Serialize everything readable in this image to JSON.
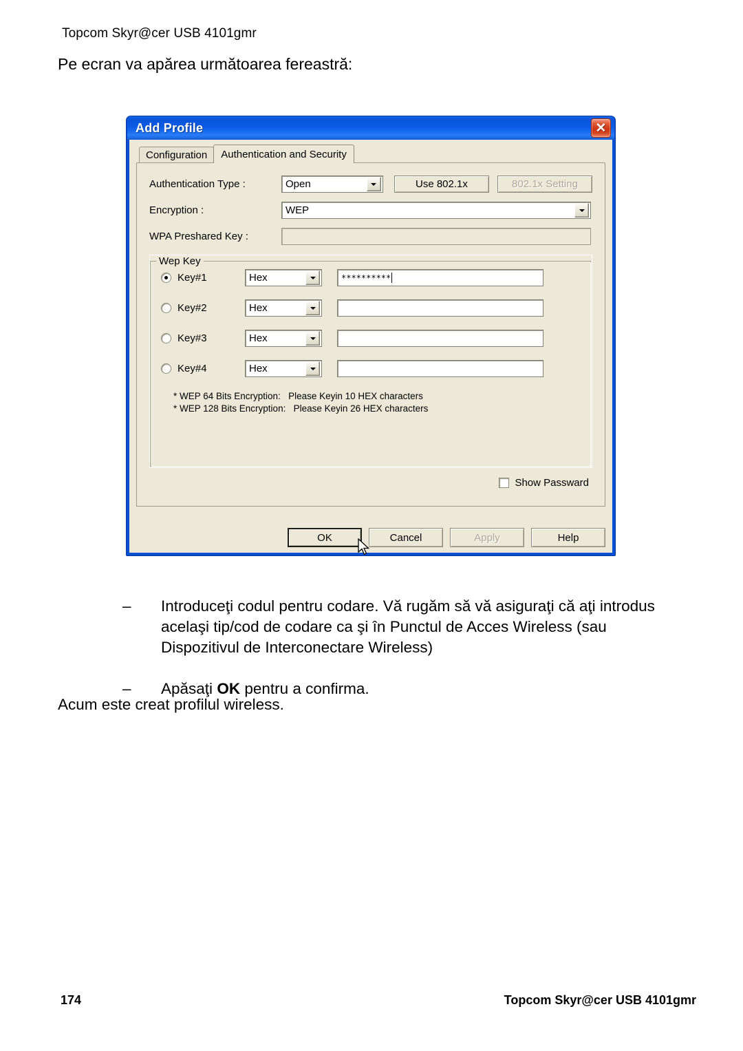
{
  "page": {
    "header": "Topcom Skyr@cer USB 4101gmr",
    "lead": "Pe ecran va apărea următoarea fereastră:",
    "closing": "Acum este creat profilul wireless.",
    "footer_page_number": "174",
    "footer_title": "Topcom Skyr@cer USB 4101gmr"
  },
  "bullets": [
    {
      "dash": "–",
      "text_before_bold": "Introduceţi codul pentru codare. Vă rugăm să vă asiguraţi că aţi introdus acelaşi tip/cod de codare ca şi în Punctul de Acces Wireless (sau Dispozitivul de Interconectare Wireless)",
      "bold": "",
      "text_after_bold": ""
    },
    {
      "dash": "–",
      "text_before_bold": "Apăsaţi ",
      "bold": "OK",
      "text_after_bold": " pentru a confirma."
    }
  ],
  "dialog": {
    "title": "Add Profile",
    "close_icon": "close-icon",
    "tabs": [
      {
        "label": "Configuration",
        "active": false
      },
      {
        "label": "Authentication and Security",
        "active": true
      }
    ],
    "fields": {
      "auth_type_label": "Authentication Type :",
      "auth_type_value": "Open",
      "use_8021x_label": "Use 802.1x",
      "setting_8021x_label": "802.1x Setting",
      "encryption_label": "Encryption :",
      "encryption_value": "WEP",
      "wpa_preshared_label": "WPA Preshared Key :",
      "wpa_preshared_value": ""
    },
    "wep_group": {
      "title": "Wep Key",
      "keys": [
        {
          "label": "Key#1",
          "selected": true,
          "format": "Hex",
          "value": "**********"
        },
        {
          "label": "Key#2",
          "selected": false,
          "format": "Hex",
          "value": ""
        },
        {
          "label": "Key#3",
          "selected": false,
          "format": "Hex",
          "value": ""
        },
        {
          "label": "Key#4",
          "selected": false,
          "format": "Hex",
          "value": ""
        }
      ],
      "note_line_1": "* WEP 64 Bits Encryption:   Please Keyin 10 HEX characters",
      "note_line_2": "* WEP 128 Bits Encryption:   Please Keyin 26 HEX characters"
    },
    "show_password_label": "Show Passward",
    "show_password_checked": false,
    "buttons": [
      {
        "label": "OK",
        "default": true,
        "disabled": false
      },
      {
        "label": "Cancel",
        "default": false,
        "disabled": false
      },
      {
        "label": "Apply",
        "default": false,
        "disabled": true
      },
      {
        "label": "Help",
        "default": false,
        "disabled": false
      }
    ]
  },
  "colors": {
    "titlebar_blue": "#0A54DB",
    "dialog_face": "#ECE9D8",
    "close_red": "#CF3615",
    "disabled_text": "#ACA899"
  }
}
